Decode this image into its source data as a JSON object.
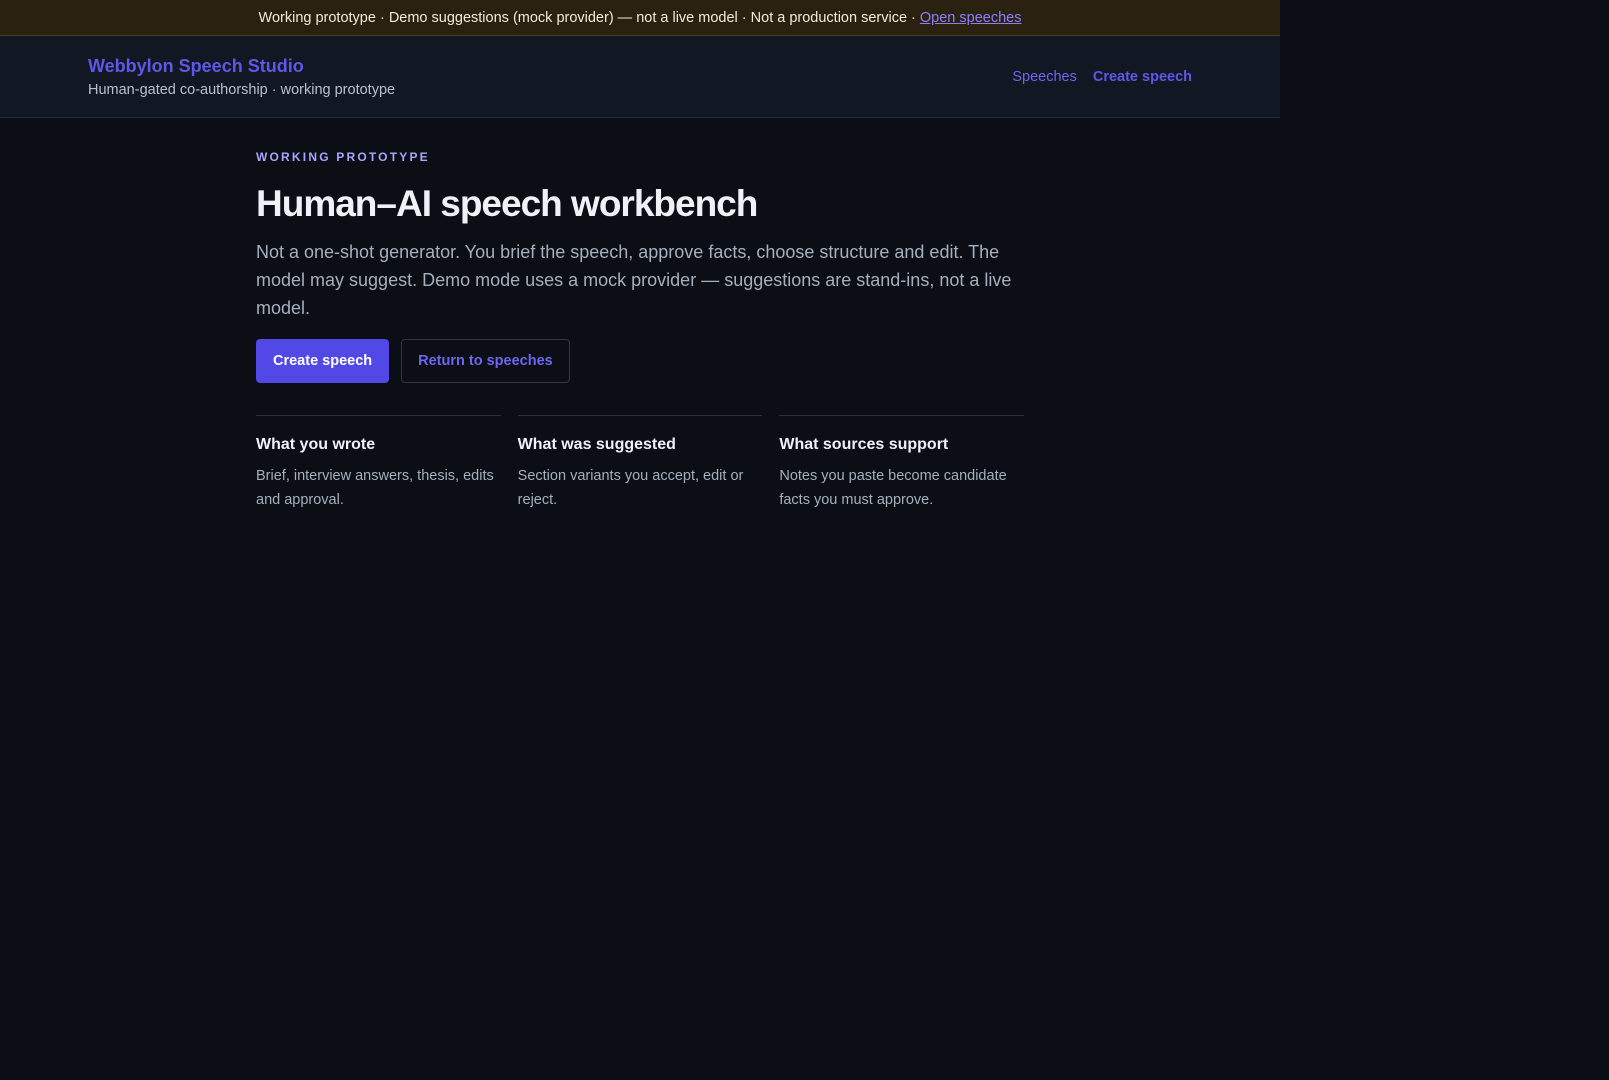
{
  "banner": {
    "text": "Working prototype · Demo suggestions (mock provider) — not a live model · Not a production service ·",
    "link_label": "Open speeches"
  },
  "header": {
    "brand_title": "Webbylon Speech Studio",
    "brand_subtitle": "Human-gated co-authorship · working prototype",
    "nav": {
      "speeches_label": "Speeches",
      "create_label": "Create speech"
    }
  },
  "main": {
    "eyebrow": "WORKING PROTOTYPE",
    "title": "Human–AI speech workbench",
    "lede": "Not a one-shot generator. You brief the speech, approve facts, choose structure and edit. The model may suggest. Demo mode uses a mock provider — suggestions are stand-ins, not a live model.",
    "actions": {
      "primary_label": "Create speech",
      "secondary_label": "Return to speeches"
    },
    "features": [
      {
        "title": "What you wrote",
        "text": "Brief, interview answers, thesis, edits and approval."
      },
      {
        "title": "What was suggested",
        "text": "Section variants you accept, edit or reject."
      },
      {
        "title": "What sources support",
        "text": "Notes you paste become candidate facts you must approve."
      }
    ]
  },
  "colors": {
    "background": "#0b0e14",
    "banner_background": "#2a2111",
    "header_background": "#121823",
    "accent": "#5148e5",
    "accent_text": "#6d66f0"
  }
}
